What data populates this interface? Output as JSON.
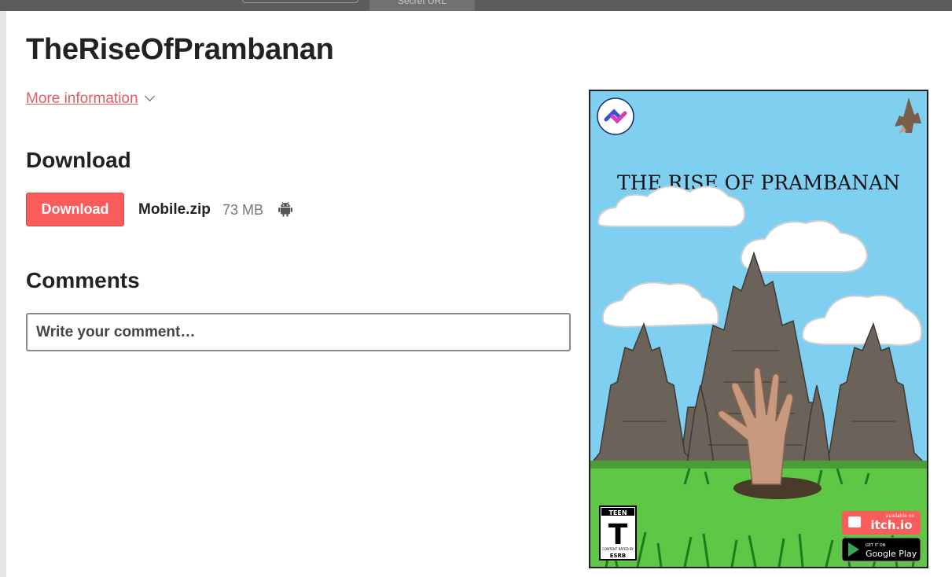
{
  "topbar": {
    "tab_label": "Secret URL"
  },
  "game": {
    "title": "TheRiseOfPrambanan",
    "more_info_label": "More information"
  },
  "download": {
    "heading": "Download",
    "button_label": "Download",
    "file_name": "Mobile.zip",
    "file_size": "73 MB",
    "platform_icon": "android-icon"
  },
  "comments": {
    "heading": "Comments",
    "placeholder": "Write your comment…"
  },
  "cover": {
    "title": "THE RISE OF PRAMBANAN",
    "rating_top": "TEEN",
    "rating_letter": "T",
    "rating_bottom": "ESRB",
    "rating_small": "CONTENT RATED BY",
    "itch_small": "available on",
    "itch_label": "itch.io",
    "gplay_small": "GET IT ON",
    "gplay_label": "Google Play",
    "sky_color": "#7fcff1",
    "grass_color": "#5ec745"
  }
}
